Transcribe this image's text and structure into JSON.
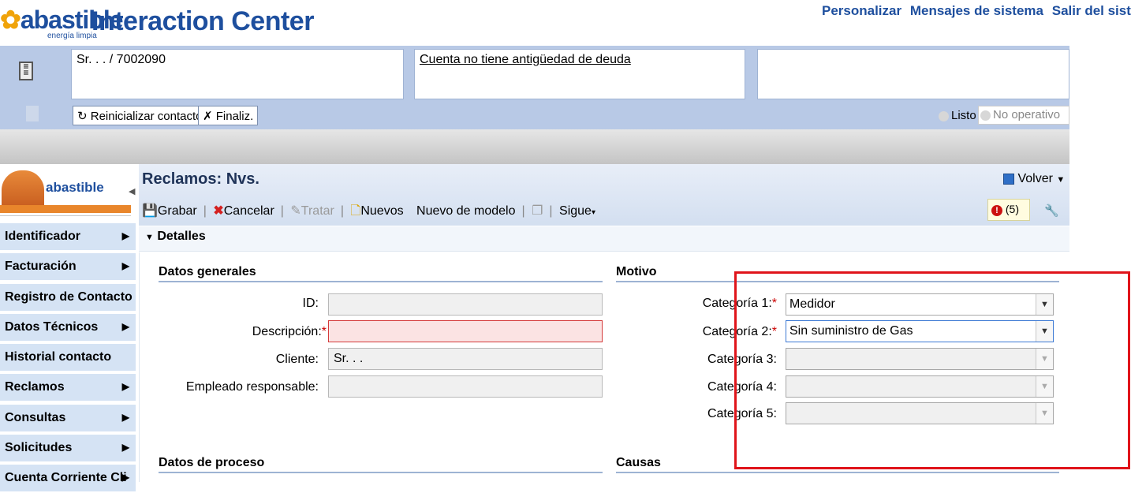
{
  "header": {
    "logo_text": "abastible",
    "logo_tagline": "energía limpia",
    "app_title": "Interaction Center",
    "links": [
      "Personalizar",
      "Mensajes de sistema",
      "Salir del siste"
    ]
  },
  "context": {
    "customer": "Sr. . . / 7002090",
    "debt_note": "Cuenta no tiene antigüedad de deuda",
    "reset_button": "Reinicializar contacto",
    "end_button": "Finaliz.",
    "status_ready": "Listo",
    "status_not_operative": "No operativo"
  },
  "nav": {
    "logo_text": "abastible",
    "items": [
      {
        "label": "Identificador",
        "arrow": true
      },
      {
        "label": "Facturación",
        "arrow": true
      },
      {
        "label": "Registro de Contacto",
        "arrow": false
      },
      {
        "label": "Datos Técnicos",
        "arrow": true
      },
      {
        "label": "Historial contacto",
        "arrow": false
      },
      {
        "label": "Reclamos",
        "arrow": true
      },
      {
        "label": "Consultas",
        "arrow": true
      },
      {
        "label": "Solicitudes",
        "arrow": true
      },
      {
        "label": "Cuenta Corriente Cli",
        "arrow": true
      }
    ]
  },
  "page": {
    "title": "Reclamos: Nvs.",
    "back_label": "Volver",
    "toolbar": {
      "save": "Grabar",
      "cancel": "Cancelar",
      "process": "Tratar",
      "new": "Nuevos",
      "new_from_template": "Nuevo de modelo",
      "next": "Sigue"
    },
    "alerts_count": "(5)",
    "panel_title": "Detalles"
  },
  "general": {
    "title": "Datos generales",
    "id_label": "ID:",
    "id_value": "",
    "description_label": "Descripción:",
    "description_value": "",
    "customer_label": "Cliente:",
    "customer_value": "Sr. . .",
    "employee_label": "Empleado responsable:",
    "employee_value": ""
  },
  "motivo": {
    "title": "Motivo",
    "cat1_label": "Categoría 1:",
    "cat1_value": "Medidor",
    "cat2_label": "Categoría 2:",
    "cat2_value": "Sin suministro de Gas",
    "cat3_label": "Categoría 3:",
    "cat3_value": "",
    "cat4_label": "Categoría 4:",
    "cat4_value": "",
    "cat5_label": "Categoría 5:",
    "cat5_value": ""
  },
  "process": {
    "title": "Datos de proceso"
  },
  "causes": {
    "title": "Causas"
  },
  "required_marker": "*",
  "colors": {
    "brand_blue": "#1e4f9e",
    "highlight_red": "#e0141a",
    "context_bar": "#b8c9e6"
  }
}
